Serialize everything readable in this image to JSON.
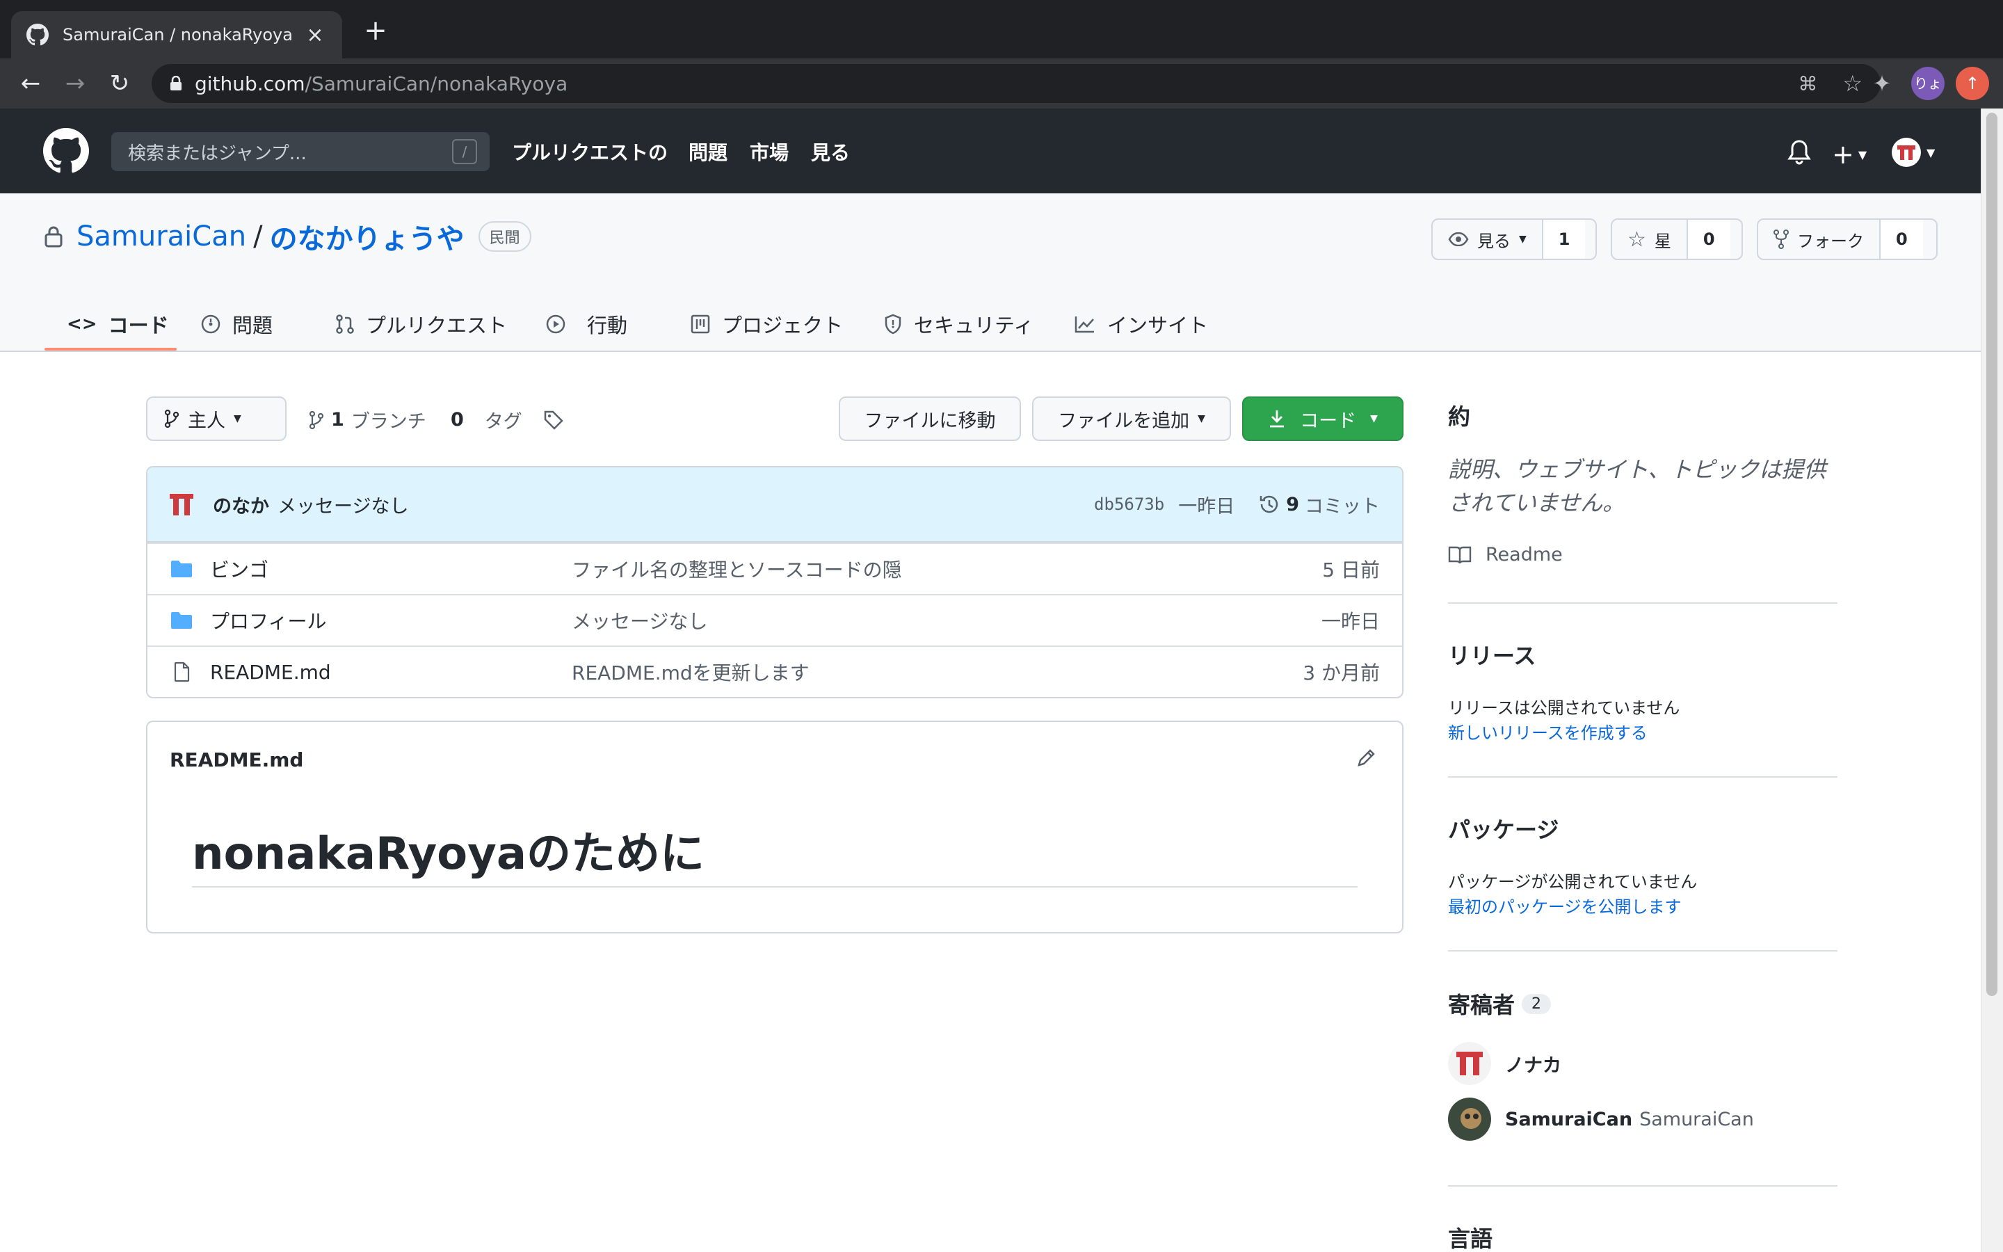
{
  "browser": {
    "tab_title": "SamuraiCan / nonakaRyoya",
    "url_domain": "github.com",
    "url_path": "/SamuraiCan/nonakaRyoya",
    "profile_initials": "りょ"
  },
  "header": {
    "search_placeholder": "検索またはジャンプ...",
    "search_shortcut": "/",
    "nav": [
      "プルリクエストの",
      "問題",
      "市場",
      "見る"
    ]
  },
  "repo": {
    "owner": "SamuraiCan",
    "separator": "/",
    "name": "のなかりょうや",
    "visibility": "民間",
    "watch_label": "見る",
    "watch_count": "1",
    "star_label": "星",
    "star_count": "0",
    "fork_label": "フォーク",
    "fork_count": "0"
  },
  "tabs": [
    "コード",
    "問題",
    "プルリクエスト",
    "行動",
    "プロジェクト",
    "セキュリティ",
    "インサイト"
  ],
  "toolbar": {
    "branch": "主人",
    "branch_count": "1",
    "branch_label": "ブランチ",
    "tag_count": "0",
    "tag_label": "タグ",
    "goto_file": "ファイルに移動",
    "add_file": "ファイルを追加",
    "code": "コード"
  },
  "commit": {
    "author": "のなか",
    "message": "メッセージなし",
    "sha": "db5673b",
    "date": "一昨日",
    "count": "9",
    "count_label": "コミット"
  },
  "files": [
    {
      "type": "dir",
      "name": "ビンゴ",
      "message": "ファイル名の整理とソースコードの隠",
      "date": "5 日前"
    },
    {
      "type": "dir",
      "name": "プロフィール",
      "message": "メッセージなし",
      "date": "一昨日"
    },
    {
      "type": "file",
      "name": "README.md",
      "message": "README.mdを更新します",
      "date": "3 か月前"
    }
  ],
  "readme": {
    "filename": "README.md",
    "heading": "nonakaRyoyaのために"
  },
  "sidebar": {
    "about_heading": "約",
    "about_text_1": "説明、ウェブサイト、トピックは提供",
    "about_text_2": "されていません。",
    "readme_link": "Readme",
    "releases_heading": "リリース",
    "releases_text": "リリースは公開されていません",
    "releases_link": "新しいリリースを作成する",
    "packages_heading": "パッケージ",
    "packages_text": "パッケージが公開されていません",
    "packages_link": "最初のパッケージを公開します",
    "contributors_heading": "寄稿者",
    "contributors_count": "2",
    "contributors": [
      {
        "login": "ノナカ",
        "name": ""
      },
      {
        "login": "SamuraiCan",
        "name": "SamuraiCan"
      }
    ],
    "languages_heading": "言語"
  },
  "colors": {
    "accent": "#0969da",
    "green": "#2da44e",
    "header_bg": "#24292f",
    "folder": "#54aeff",
    "tab_underline": "#fd8c73",
    "avatar_red": "#cf3a3f"
  }
}
